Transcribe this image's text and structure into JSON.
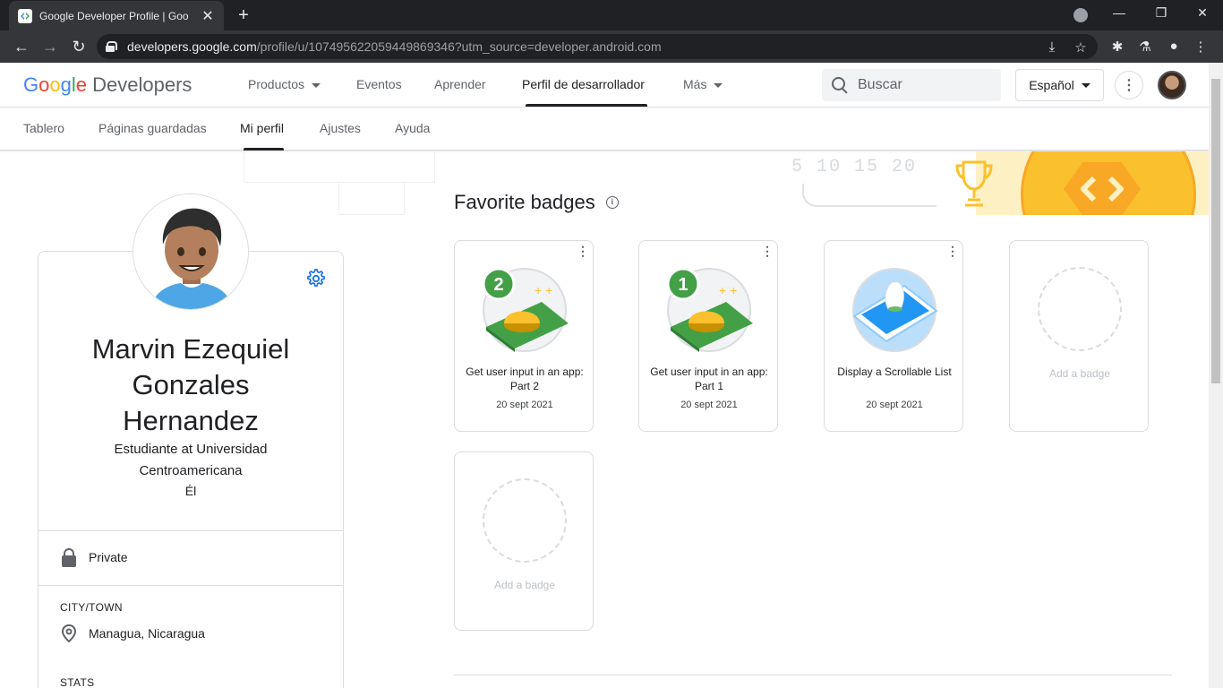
{
  "browser": {
    "tab_title": "Google Developer Profile  |  Goo",
    "url_host": "developers.google.com",
    "url_path": "/profile/u/107495622059449869346?utm_source=developer.android.com"
  },
  "header": {
    "logo_google": [
      "G",
      "o",
      "o",
      "g",
      "l",
      "e"
    ],
    "logo_developers": "Developers",
    "nav": [
      {
        "label": "Productos"
      },
      {
        "label": "Eventos"
      },
      {
        "label": "Aprender"
      },
      {
        "label": "Perfil de desarrollador"
      },
      {
        "label": "Más"
      }
    ],
    "search_placeholder": "Buscar",
    "language": "Español"
  },
  "subnav": [
    {
      "label": "Tablero"
    },
    {
      "label": "Páginas guardadas"
    },
    {
      "label": "Mi perfil"
    },
    {
      "label": "Ajustes"
    },
    {
      "label": "Ayuda"
    }
  ],
  "banner": {
    "numbers": "5  10  15  20"
  },
  "profile": {
    "name_lines": [
      "Marvin Ezequiel",
      "Gonzales",
      "Hernandez"
    ],
    "title_lines": [
      "Estudiante at Universidad",
      "Centroamericana"
    ],
    "pronoun": "Él",
    "visibility": "Private",
    "city_heading": "CITY/TOWN",
    "city": "Managua, Nicaragua",
    "stats_heading": "STATS"
  },
  "badges": {
    "heading": "Favorite badges",
    "items": [
      {
        "number": "2",
        "name": "Get user input in an app: Part 2",
        "date": "20 sept 2021"
      },
      {
        "number": "1",
        "name": "Get user input in an app: Part 1",
        "date": "20 sept 2021"
      },
      {
        "number": "",
        "name": "Display a Scrollable List",
        "date": "20 sept 2021"
      }
    ],
    "add_label": "Add a badge"
  },
  "colors": {
    "accent_blue": "#1a73e8",
    "badge_green": "#43a047",
    "banner_yellow": "#fbc02d"
  }
}
